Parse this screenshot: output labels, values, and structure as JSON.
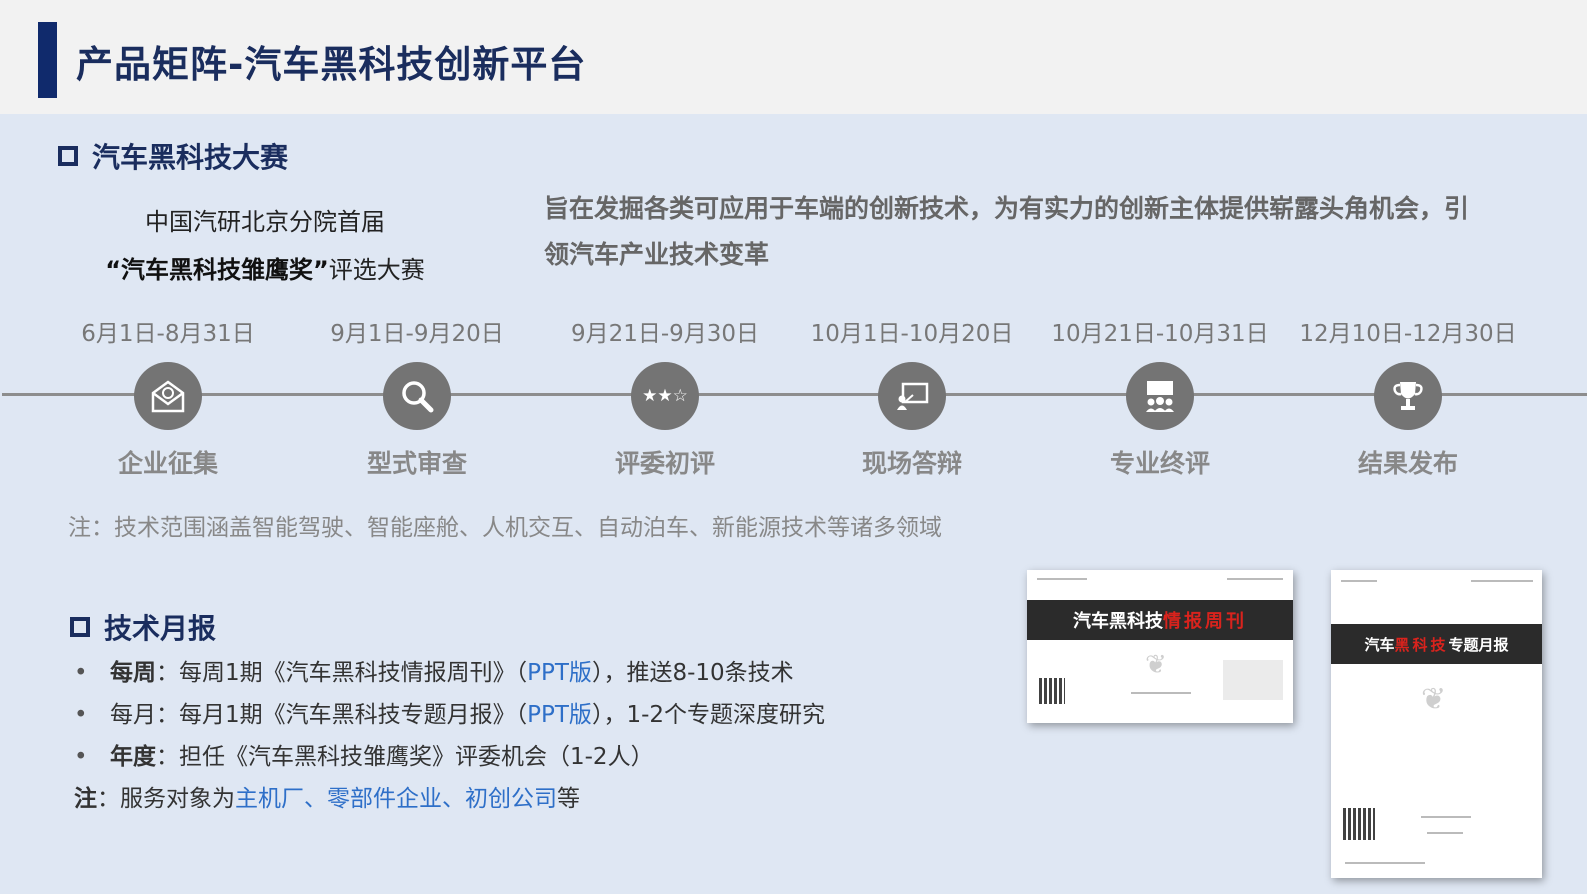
{
  "header": {
    "title": "产品矩阵-汽车黑科技创新平台"
  },
  "competition": {
    "section_title": "汽车黑科技大赛",
    "intro_line1": "中国汽研北京分院首届",
    "intro_line2_bold": "“汽车黑科技雏鹰奖”",
    "intro_line2_rest": "评选大赛",
    "description_line1": "旨在发掘各类可应用于车端的创新技术，为有实力的创新主体提供崭露头角机会，引",
    "description_line2": "领汽车产业技术变革",
    "steps": [
      {
        "date": "6月1日-8月31日",
        "label": "企业征集",
        "icon": "envelope-icon"
      },
      {
        "date": "9月1日-9月20日",
        "label": "型式审查",
        "icon": "search-icon"
      },
      {
        "date": "9月21日-9月30日",
        "label": "评委初评",
        "icon": "stars-icon"
      },
      {
        "date": "10月1日-10月20日",
        "label": "现场答辩",
        "icon": "presentation-icon"
      },
      {
        "date": "10月21日-10月31日",
        "label": "专业终评",
        "icon": "meeting-icon"
      },
      {
        "date": "12月10日-12月30日",
        "label": "结果发布",
        "icon": "trophy-icon"
      }
    ],
    "note": "注：技术范围涵盖智能驾驶、智能座舱、人机交互、自动泊车、新能源技术等诸多领域"
  },
  "monthly": {
    "section_title": "技术月报",
    "items": [
      {
        "bullet": "•",
        "lead": "每周",
        "text1": "：每周1期《汽车黑科技情报周刊》（",
        "link": "PPT版",
        "text2": "），推送8-10条技术"
      },
      {
        "bullet": "•",
        "lead": "每月",
        "text1": "：每月1期《汽车黑科技专题月报》（",
        "link": "PPT版",
        "text2": "），1-2个专题深度研究"
      },
      {
        "bullet": "•",
        "lead": "年度",
        "text1": "：担任《汽车黑科技雏鹰奖》评委机会（1-2人）",
        "link": "",
        "text2": ""
      }
    ],
    "note_lead": "注",
    "note_text": "：服务对象为",
    "note_highlight": "主机厂、零部件企业、初创公司",
    "note_tail": "等"
  },
  "doc_weekly": {
    "title_white": "汽车黑科技",
    "title_red": "情报周刊"
  },
  "doc_monthly": {
    "title_white1": "汽车",
    "title_red": "黑科技",
    "title_white2": "专题月报"
  },
  "colors": {
    "navy": "#1a2d5e",
    "accent_bar": "#102a6c",
    "link_blue": "#2e6fc8",
    "timeline_gray": "#747474",
    "background": "#dfe7f3"
  }
}
